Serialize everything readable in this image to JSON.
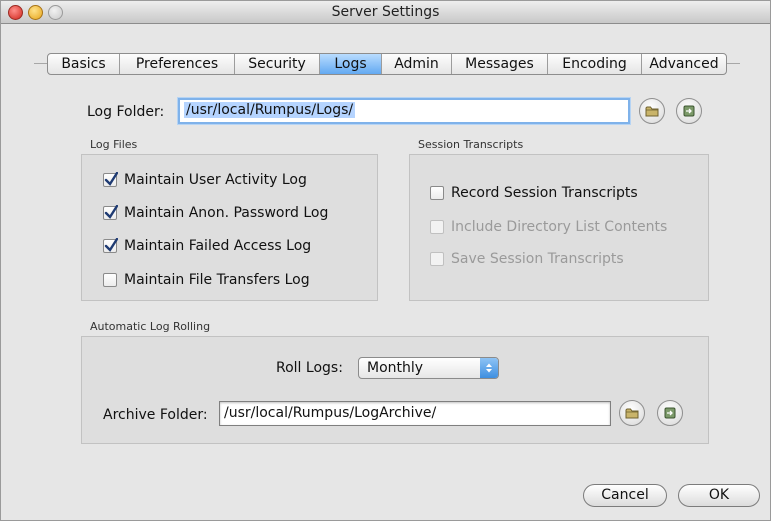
{
  "window": {
    "title": "Server Settings"
  },
  "tabs": [
    {
      "label": "Basics",
      "active": false
    },
    {
      "label": "Preferences",
      "active": false
    },
    {
      "label": "Security",
      "active": false
    },
    {
      "label": "Logs",
      "active": true
    },
    {
      "label": "Admin",
      "active": false
    },
    {
      "label": "Messages",
      "active": false
    },
    {
      "label": "Encoding",
      "active": false
    },
    {
      "label": "Advanced",
      "active": false
    }
  ],
  "log_folder": {
    "label": "Log Folder:",
    "value": "/usr/local/Rumpus/Logs/"
  },
  "log_files": {
    "title": "Log Files",
    "items": [
      {
        "label": "Maintain User Activity Log",
        "checked": true
      },
      {
        "label": "Maintain Anon. Password Log",
        "checked": true
      },
      {
        "label": "Maintain Failed Access Log",
        "checked": true
      },
      {
        "label": "Maintain File Transfers Log",
        "checked": false
      }
    ]
  },
  "session_transcripts": {
    "title": "Session Transcripts",
    "items": [
      {
        "label": "Record Session Transcripts",
        "checked": false,
        "enabled": true
      },
      {
        "label": "Include Directory List Contents",
        "checked": false,
        "enabled": false
      },
      {
        "label": "Save Session Transcripts",
        "checked": false,
        "enabled": false
      }
    ]
  },
  "rolling": {
    "title": "Automatic Log Rolling",
    "roll_label": "Roll Logs:",
    "roll_value": "Monthly",
    "archive_label": "Archive Folder:",
    "archive_value": "/usr/local/Rumpus/LogArchive/"
  },
  "buttons": {
    "cancel": "Cancel",
    "ok": "OK"
  },
  "colors": {
    "accent": "#63a9f1",
    "focus_ring": "#7fb2ea",
    "selection": "#b5d4ff"
  }
}
